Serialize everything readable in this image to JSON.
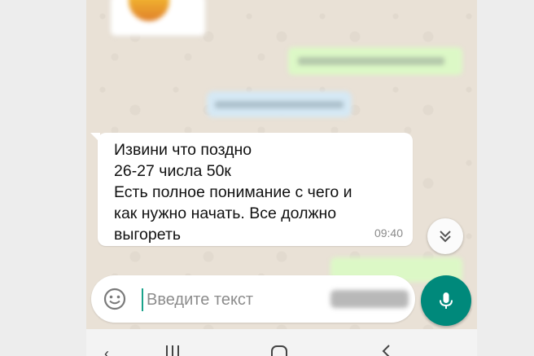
{
  "chat": {
    "incoming_message": {
      "text": "Извини что поздно\n26-27 числа 50к\nЕсть полное понимание с чего и\nкак нужно начать. Все должно\nвыгореть",
      "time": "09:40"
    }
  },
  "composer": {
    "placeholder": "Введите текст"
  },
  "icons": {
    "emoji": "emoji-icon",
    "mic": "mic-icon",
    "scroll_down": "double-chevron-down-icon"
  },
  "colors": {
    "accent": "#00897b",
    "sent_bubble": "#dcf8c6",
    "chat_background": "#e9e1d6"
  }
}
